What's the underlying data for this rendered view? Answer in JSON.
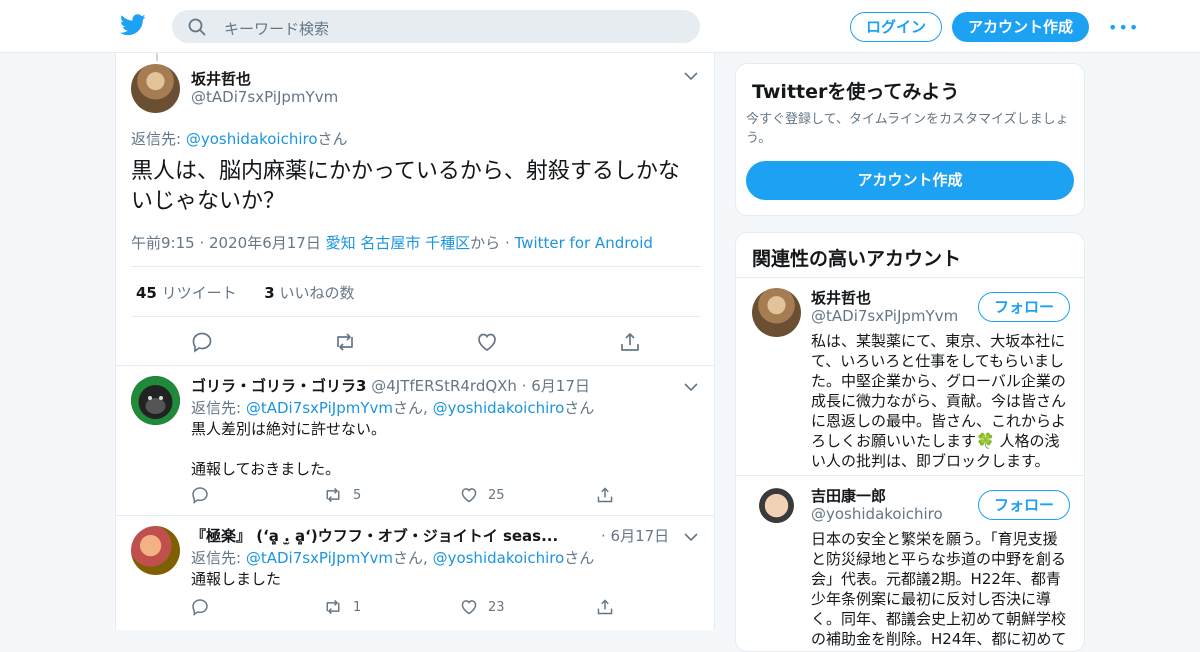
{
  "header": {
    "search_placeholder": "キーワード検索",
    "login_label": "ログイン",
    "signup_label": "アカウント作成",
    "more_label": "•••"
  },
  "main_tweet": {
    "name": "坂井哲也",
    "handle": "@tADi7sxPiJpmYvm",
    "reply_prefix": "返信先: ",
    "reply_to": "@yoshidakoichiro",
    "reply_suffix": "さん",
    "text": "黒人は、脳内麻薬にかかっているから、射殺するしかないじゃないか？",
    "time": "午前9:15",
    "date": "2020年6月17日",
    "location": "愛知 名古屋市 千種区",
    "from_label": "から",
    "client": "Twitter for Android",
    "retweets_count": "45",
    "retweets_label": "リツイート",
    "likes_count": "3",
    "likes_label": "いいねの数"
  },
  "replies": [
    {
      "name": "ゴリラ・ゴリラ・ゴリラ3",
      "handle": "@4JTfERStR4rdQXh",
      "date": "6月17日",
      "reply_prefix": "返信先: ",
      "reply_to_1": "@tADi7sxPiJpmYvm",
      "reply_mid": "さん, ",
      "reply_to_2": "@yoshidakoichiro",
      "reply_suffix": "さん",
      "text": "黒人差別は絶対に許せない。\n\n通報しておきました。",
      "retweets": "5",
      "likes": "25"
    },
    {
      "name": "『極楽』 (ʻa͈̥ .̫ a͈̥ʻ)ウフフ・オブ・ジョイトイ seas...",
      "handle": "",
      "date": "6月17日",
      "reply_prefix": "返信先: ",
      "reply_to_1": "@tADi7sxPiJpmYvm",
      "reply_mid": "さん, ",
      "reply_to_2": "@yoshidakoichiro",
      "reply_suffix": "さん",
      "text": "通報しました",
      "retweets": "1",
      "likes": "23"
    }
  ],
  "sidebar": {
    "promo": {
      "title": "Twitterを使ってみよう",
      "subtitle": "今すぐ登録して、タイムラインをカスタマイズしましょう。",
      "cta": "アカウント作成"
    },
    "related": {
      "title": "関連性の高いアカウント",
      "follow_label": "フォロー",
      "accounts": [
        {
          "name": "坂井哲也",
          "handle": "@tADi7sxPiJpmYvm",
          "bio": "私は、某製薬にて、東京、大坂本社にて、いろいろと仕事をしてもらいました。中堅企業から、グローバル企業の成長に微力ながら、貢献。今は皆さんに恩返しの最中。皆さん、これからよろしくお願いいたします🍀 人格の浅い人の批判は、即ブロックします。"
        },
        {
          "name": "吉田康一郎",
          "handle": "@yoshidakoichiro",
          "bio": "日本の安全と繁栄を願う。「育児支援と防災緑地と平らな歩道の中野を創る会」代表。元都議2期。H22年、都青少年条例案に最初に反対し否決に導く。同年、都議会史上初めて朝鮮学校の補助金を削除。H24年、都に初めて"
        }
      ]
    }
  },
  "colors": {
    "accent": "#1da1f2",
    "link": "#1b95e0",
    "muted": "#657786",
    "border": "#e6ecf0",
    "background": "#f5f8fa"
  }
}
